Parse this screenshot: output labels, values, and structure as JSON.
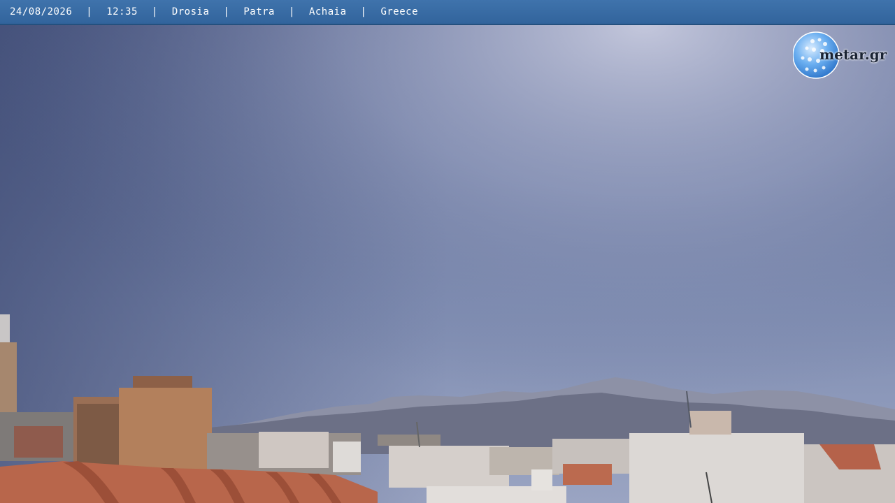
{
  "overlay": {
    "date": "24/08/2026",
    "time": "12:35",
    "place": "Drosia",
    "city": "Patra",
    "region": "Achaia",
    "country": "Greece",
    "separator": "|"
  },
  "logo": {
    "text": "metar.gr",
    "icon": "globe-icon"
  },
  "colors": {
    "bar": "#3a6ca6",
    "sky_top": "#4c5a86",
    "sky_bright": "#b9bfd8",
    "mountain": "#6b7188",
    "roof": "#b8664b"
  }
}
